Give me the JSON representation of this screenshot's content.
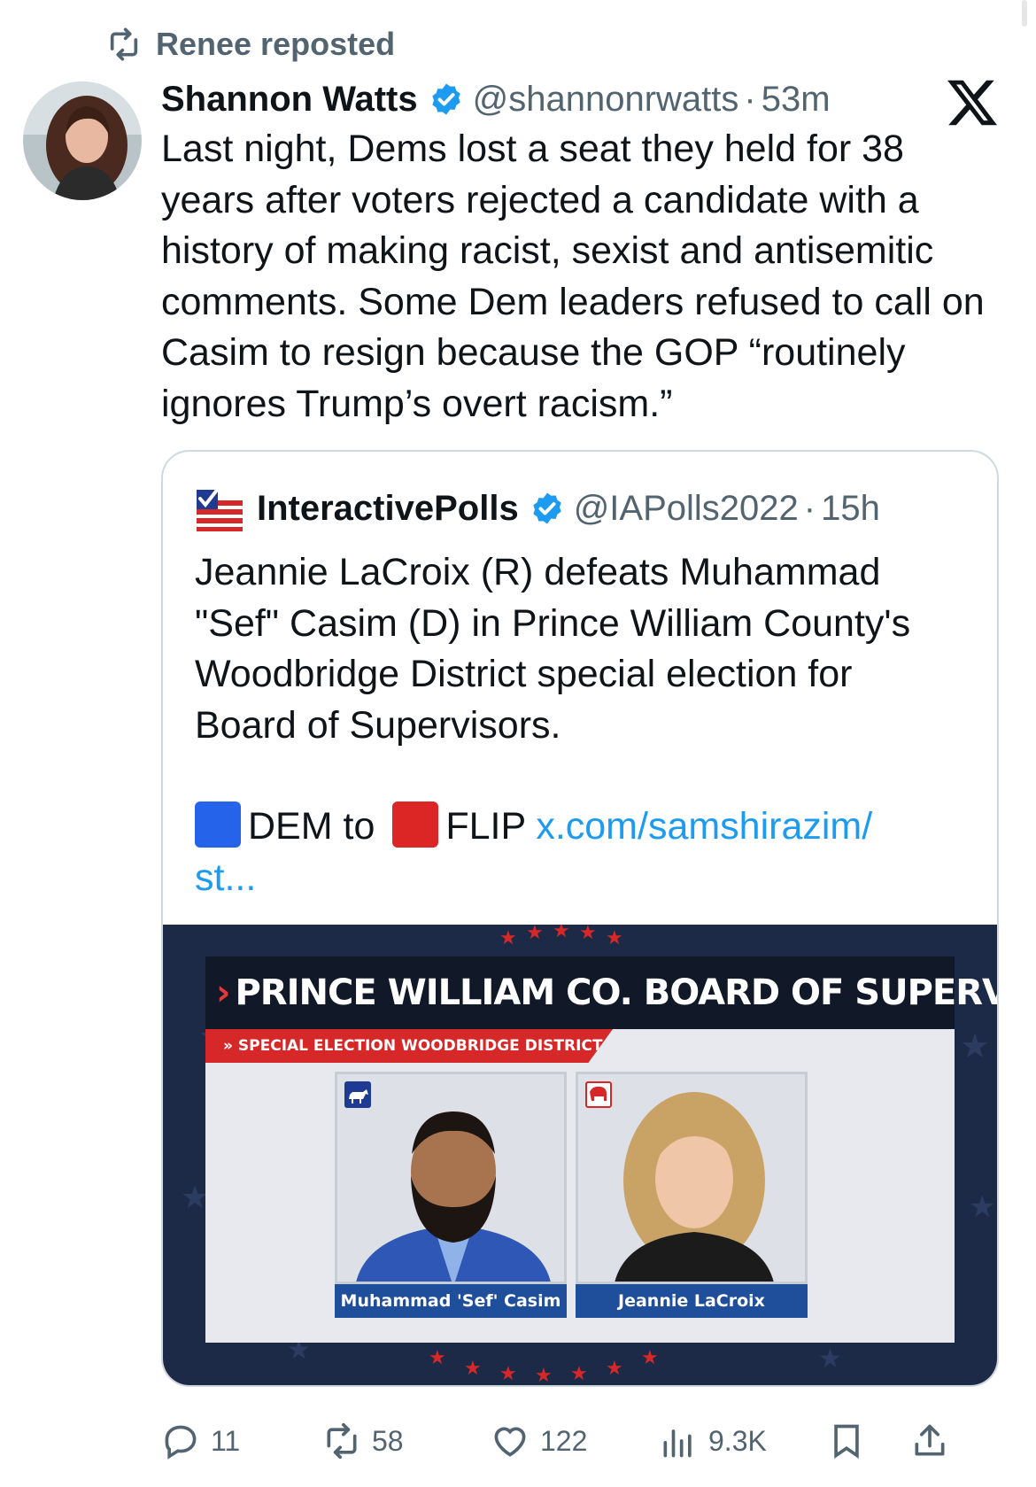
{
  "repost": {
    "label": "Renee reposted",
    "icon": "repost-icon"
  },
  "tweet": {
    "author_name": "Shannon Watts",
    "handle": "@shannonrwatts",
    "separator": "·",
    "time": "53m",
    "verified": true,
    "text": "Last night, Dems lost a seat they held for 38 years after voters rejected a candidate with a history of making racist, sexist and antisemitic comments. Some Dem leaders refused to call on Casim to resign because the GOP “routinely ignores Trump’s overt racism.”"
  },
  "quote": {
    "author_name": "InteractivePolls",
    "handle": "@IAPolls2022",
    "separator": "·",
    "time": "15h",
    "verified": true,
    "text": "Jeannie LaCroix (R) defeats Muhammad \"Sef\" Casim (D) in Prince William County's Woodbridge District special election for Board of Supervisors.",
    "flip_dem": "DEM to",
    "flip_text": "FLIP",
    "link_line1": "x.com/samshirazim/",
    "link_line2": "st..."
  },
  "media": {
    "title": "PRINCE WILLIAM CO. BOARD OF SUPERVISOR",
    "subtitle": "» SPECIAL ELECTION  WOODBRIDGE DISTRICT",
    "candidate_left": "Muhammad 'Sef' Casim",
    "candidate_right": "Jeannie LaCroix"
  },
  "actions": {
    "replies": "11",
    "reposts": "58",
    "likes": "122",
    "views": "9.3K"
  },
  "colors": {
    "accent": "#1d9bf0",
    "muted": "#536471",
    "border": "#cfd9de",
    "dem_blue": "#2563eb",
    "gop_red": "#dc2626"
  }
}
